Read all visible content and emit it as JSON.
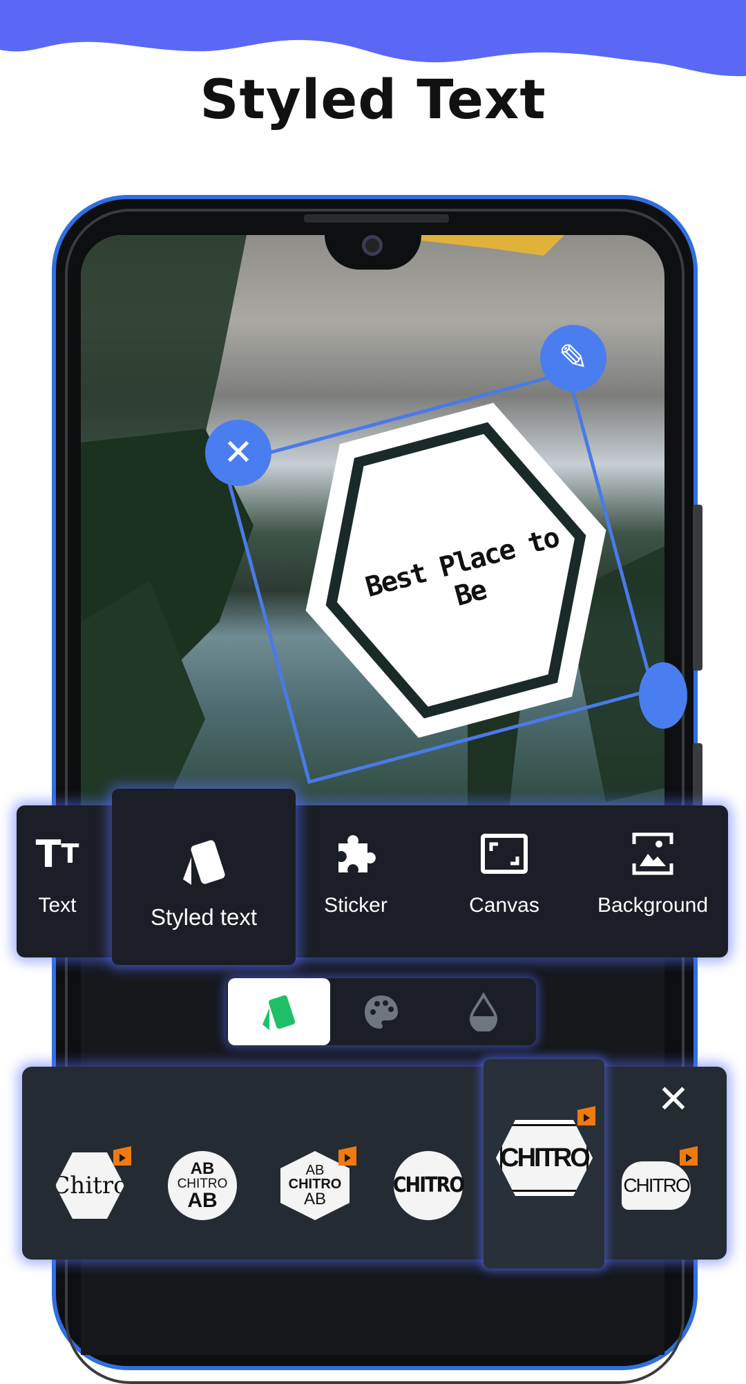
{
  "header": {
    "title": "Styled Text"
  },
  "colors": {
    "brand_wave": "#5b68f5",
    "selection": "#4a7ef0",
    "accent_green": "#1fbf6a",
    "premium_badge": "#f07a10"
  },
  "canvas": {
    "sticker_text": "Best Place to Be",
    "handles": [
      "close-icon",
      "pencil-icon",
      "resize-icon"
    ]
  },
  "toolbar": {
    "items": [
      {
        "label": "Text",
        "icon": "text-size-icon"
      },
      {
        "label": "Styled text",
        "icon": "cards-icon",
        "selected": true
      },
      {
        "label": "Sticker",
        "icon": "puzzle-icon"
      },
      {
        "label": "Canvas",
        "icon": "canvas-icon"
      },
      {
        "label": "Background",
        "icon": "background-image-icon"
      }
    ]
  },
  "subtabs": [
    {
      "icon": "cards-icon",
      "selected": true
    },
    {
      "icon": "palette-icon"
    },
    {
      "icon": "opacity-drop-icon"
    }
  ],
  "styles": {
    "close_icon": "close-icon",
    "items": [
      {
        "lines": [
          "Chitro"
        ],
        "shape": "hexagon",
        "premium": true
      },
      {
        "lines": [
          "AB",
          "CHITRO",
          "AB"
        ],
        "shape": "circle",
        "premium": false
      },
      {
        "lines": [
          "AB",
          "CHITRO",
          "AB"
        ],
        "shape": "outlined-hexagon",
        "premium": true
      },
      {
        "lines": [
          "CHITRO"
        ],
        "shape": "circle",
        "premium": false
      },
      {
        "lines": [
          "CHITRO"
        ],
        "shape": "double-hexagon",
        "premium": true,
        "selected": true
      },
      {
        "lines": [
          "CHITRO"
        ],
        "shape": "cloud",
        "premium": true
      }
    ]
  }
}
